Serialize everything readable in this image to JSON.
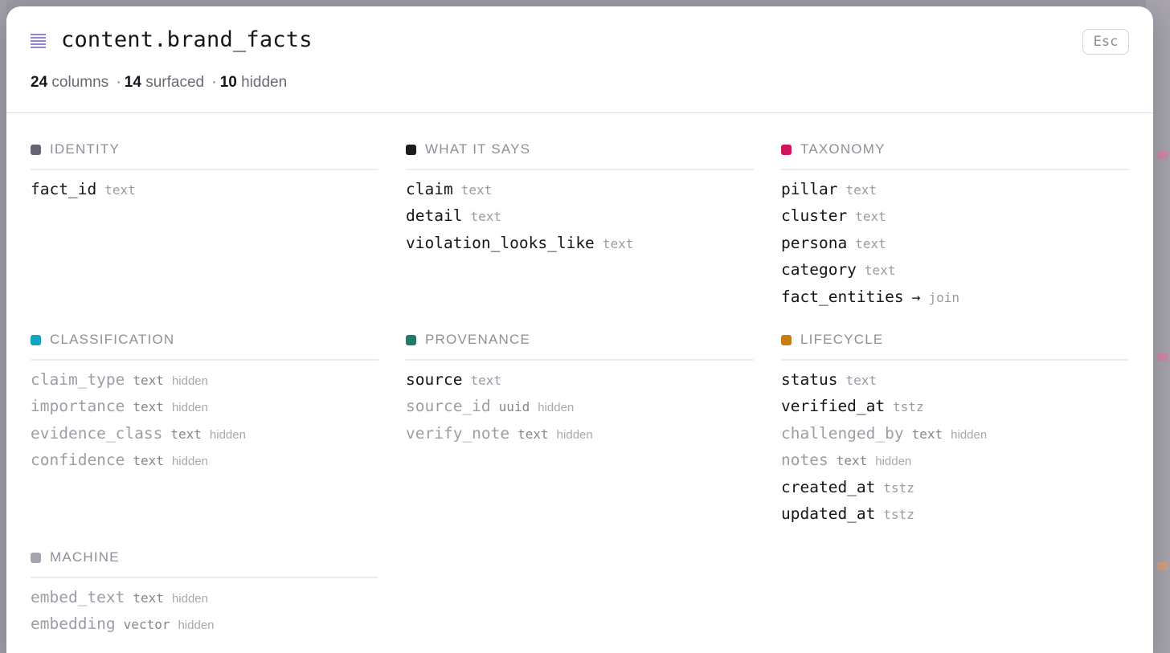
{
  "table": {
    "name": "content.brand_facts",
    "close_label": "Esc"
  },
  "stats": {
    "columns": "24",
    "columns_label": "columns",
    "surfaced": "14",
    "surfaced_label": "surfaced",
    "hidden": "10",
    "hidden_label": "hidden",
    "separator": "·"
  },
  "groups": [
    {
      "title": "IDENTITY",
      "color": "#646573",
      "columns": [
        {
          "name": "fact_id",
          "type": "text",
          "hidden": false
        }
      ]
    },
    {
      "title": "WHAT IT SAYS",
      "color": "#1c1c22",
      "columns": [
        {
          "name": "claim",
          "type": "text",
          "hidden": false
        },
        {
          "name": "detail",
          "type": "text",
          "hidden": false
        },
        {
          "name": "violation_looks_like",
          "type": "text",
          "hidden": false
        }
      ]
    },
    {
      "title": "TAXONOMY",
      "color": "#d0145d",
      "columns": [
        {
          "name": "pillar",
          "type": "text",
          "hidden": false
        },
        {
          "name": "cluster",
          "type": "text",
          "hidden": false
        },
        {
          "name": "persona",
          "type": "text",
          "hidden": false
        },
        {
          "name": "category",
          "type": "text",
          "hidden": false
        },
        {
          "name": "fact_entities",
          "type": "join",
          "arrow": "→",
          "hidden": false
        }
      ]
    },
    {
      "title": "CLASSIFICATION",
      "color": "#0fa4c4",
      "columns": [
        {
          "name": "claim_type",
          "type": "text",
          "hidden": true
        },
        {
          "name": "importance",
          "type": "text",
          "hidden": true
        },
        {
          "name": "evidence_class",
          "type": "text",
          "hidden": true
        },
        {
          "name": "confidence",
          "type": "text",
          "hidden": true
        }
      ]
    },
    {
      "title": "PROVENANCE",
      "color": "#1f7b6c",
      "columns": [
        {
          "name": "source",
          "type": "text",
          "hidden": false
        },
        {
          "name": "source_id",
          "type": "uuid",
          "hidden": true
        },
        {
          "name": "verify_note",
          "type": "text",
          "hidden": true
        }
      ]
    },
    {
      "title": "LIFECYCLE",
      "color": "#c67e0e",
      "columns": [
        {
          "name": "status",
          "type": "text",
          "hidden": false
        },
        {
          "name": "verified_at",
          "type": "tstz",
          "hidden": false
        },
        {
          "name": "challenged_by",
          "type": "text",
          "hidden": true
        },
        {
          "name": "notes",
          "type": "text",
          "hidden": true
        },
        {
          "name": "created_at",
          "type": "tstz",
          "hidden": false
        },
        {
          "name": "updated_at",
          "type": "tstz",
          "hidden": false
        }
      ]
    },
    {
      "title": "MACHINE",
      "color": "#a3a4ad",
      "columns": [
        {
          "name": "embed_text",
          "type": "text",
          "hidden": true
        },
        {
          "name": "embedding",
          "type": "vector",
          "hidden": true
        }
      ]
    }
  ],
  "hidden_tag": "hidden"
}
